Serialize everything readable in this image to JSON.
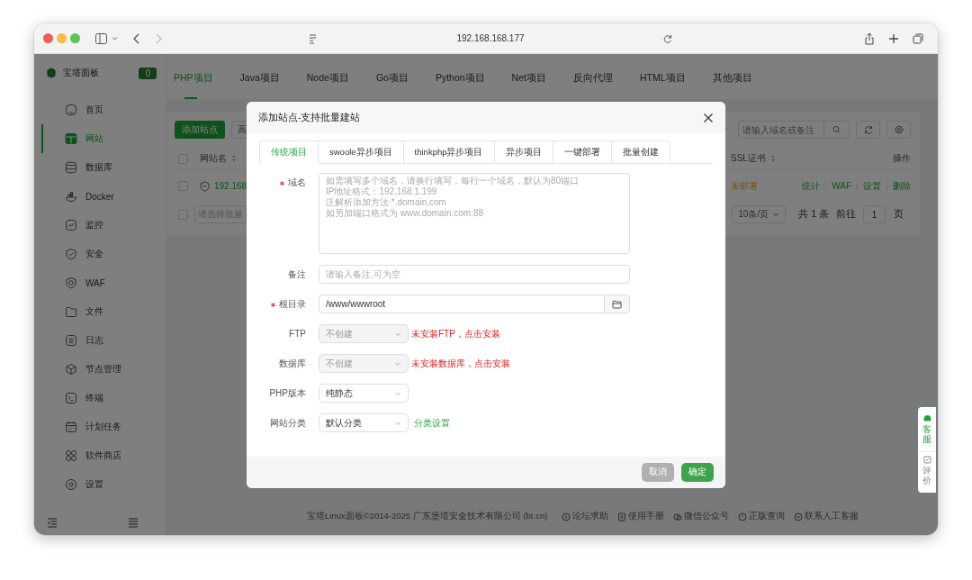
{
  "browser": {
    "address": "192.168.168.177"
  },
  "sidebar": {
    "brand": "宝塔面板",
    "badge": "0",
    "items": [
      {
        "label": "首页",
        "selected": false
      },
      {
        "label": "网站",
        "selected": true
      },
      {
        "label": "数据库",
        "selected": false
      },
      {
        "label": "Docker",
        "selected": false
      },
      {
        "label": "监控",
        "selected": false
      },
      {
        "label": "安全",
        "selected": false
      },
      {
        "label": "WAF",
        "selected": false
      },
      {
        "label": "文件",
        "selected": false
      },
      {
        "label": "日志",
        "selected": false
      },
      {
        "label": "节点管理",
        "selected": false
      },
      {
        "label": "终端",
        "selected": false
      },
      {
        "label": "计划任务",
        "selected": false
      },
      {
        "label": "软件商店",
        "selected": false
      },
      {
        "label": "设置",
        "selected": false
      }
    ]
  },
  "project_tabs": [
    {
      "label": "PHP项目",
      "selected": true
    },
    {
      "label": "Java项目",
      "selected": false
    },
    {
      "label": "Node项目",
      "selected": false
    },
    {
      "label": "Go项目",
      "selected": false
    },
    {
      "label": "Python项目",
      "selected": false
    },
    {
      "label": "Net项目",
      "selected": false
    },
    {
      "label": "反向代理",
      "selected": false
    },
    {
      "label": "HTML项目",
      "selected": false
    },
    {
      "label": "其他项目",
      "selected": false
    }
  ],
  "toolbar": {
    "add_button": "添加站点",
    "filter_button": "高",
    "search_placeholder": "请输入域名或备注"
  },
  "table": {
    "select_all_checked": false,
    "columns": [
      "网站名",
      "SSL证书",
      "操作"
    ],
    "rows": [
      {
        "checked": false,
        "name": "192.168.",
        "ssl": "未部署",
        "actions": [
          "统计",
          "WAF",
          "设置",
          "删除"
        ]
      }
    ]
  },
  "pagination": {
    "checked": false,
    "batch_placeholder": "请选择批量",
    "page_size": "10条/页",
    "total": "共 1 条",
    "goto": "前往",
    "page": "1",
    "unit": "页"
  },
  "footer": {
    "copyright": "宝塔Linux面板©2014-2025 广东堡塔安全技术有限公司 (bt.cn)",
    "links": [
      "论坛求助",
      "使用手册",
      "微信公众号",
      "正版查询",
      "联系人工客服"
    ]
  },
  "side_float": [
    "客服",
    "评价"
  ],
  "dialog": {
    "title": "添加站点-支持批量建站",
    "tabs": [
      {
        "label": "传统项目",
        "selected": true
      },
      {
        "label": "swoole异步项目",
        "selected": false
      },
      {
        "label": "thinkphp异步项目",
        "selected": false
      },
      {
        "label": "异步项目",
        "selected": false
      },
      {
        "label": "一键部署",
        "selected": false
      },
      {
        "label": "批量创建",
        "selected": false
      }
    ],
    "fields": [
      {
        "kind": "textarea",
        "label": "域名",
        "required": true,
        "placeholder": "如需填写多个域名，请换行填写，每行一个域名，默认为80端口\nIP地址格式：192.168.1.199\n泛解析添加方法 *.domain.com\n如另加端口格式为 www.domain.com:88"
      },
      {
        "kind": "input",
        "label": "备注",
        "required": false,
        "placeholder": "请输入备注,可为空"
      },
      {
        "kind": "path",
        "label": "根目录",
        "required": true,
        "value": "/www/wwwroot"
      },
      {
        "kind": "select",
        "label": "FTP",
        "required": false,
        "value": "不创建",
        "disabled": true,
        "note": {
          "text": "未安装FTP，点击安装",
          "kind": "warning"
        }
      },
      {
        "kind": "select",
        "label": "数据库",
        "required": false,
        "value": "不创建",
        "disabled": true,
        "note": {
          "text": "未安装数据库，点击安装",
          "kind": "warning"
        }
      },
      {
        "kind": "select",
        "label": "PHP版本",
        "required": false,
        "value": "纯静态",
        "disabled": false
      },
      {
        "kind": "select",
        "label": "网站分类",
        "required": false,
        "value": "默认分类",
        "disabled": false,
        "note": {
          "text": "分类设置",
          "kind": "link"
        }
      }
    ],
    "buttons": [
      {
        "label": "取消",
        "kind": "secondary"
      },
      {
        "label": "确定",
        "kind": "primary"
      }
    ]
  }
}
